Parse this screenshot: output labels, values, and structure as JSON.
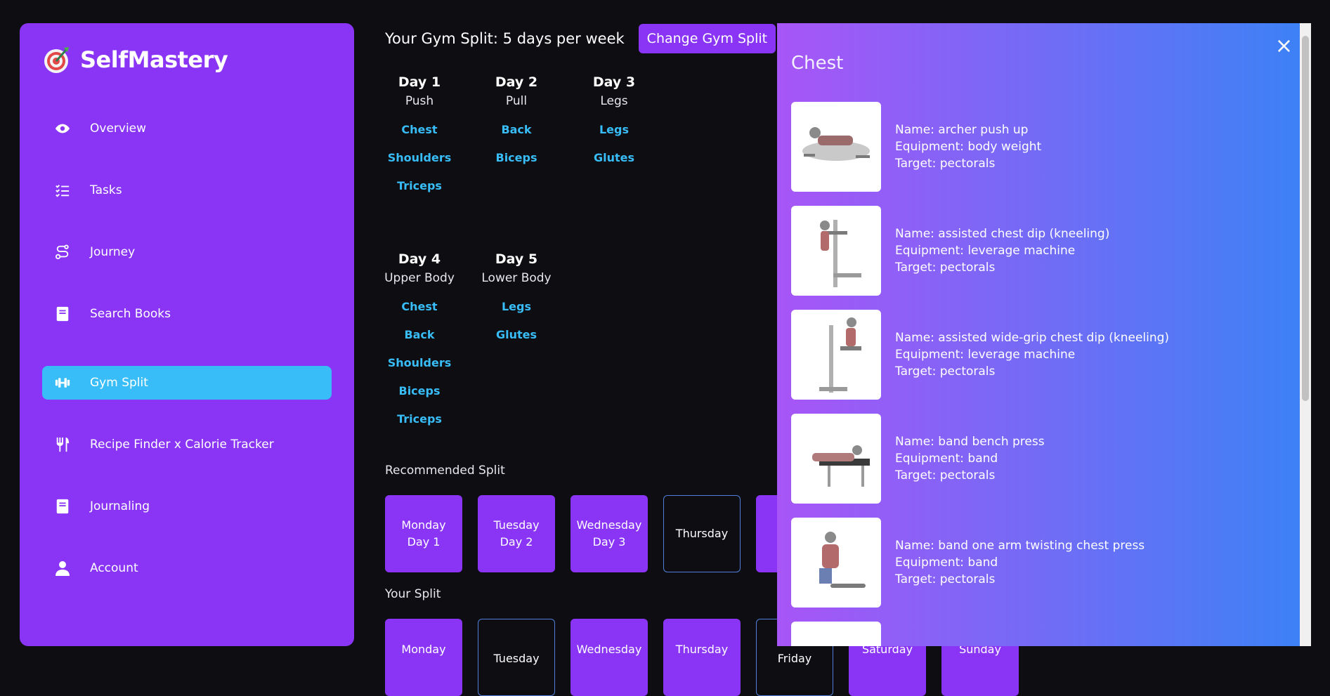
{
  "brand": {
    "name": "SelfMastery",
    "icon": "target-icon"
  },
  "nav": [
    {
      "label": "Overview",
      "icon": "eye-icon"
    },
    {
      "label": "Tasks",
      "icon": "checklist-icon"
    },
    {
      "label": "Journey",
      "icon": "route-icon"
    },
    {
      "label": "Search Books",
      "icon": "book-icon"
    },
    {
      "label": "Gym Split",
      "icon": "dumbbell-icon",
      "active": true
    },
    {
      "label": "Recipe Finder x Calorie Tracker",
      "icon": "utensils-icon"
    },
    {
      "label": "Journaling",
      "icon": "journal-icon"
    },
    {
      "label": "Account",
      "icon": "user-icon"
    }
  ],
  "header": {
    "title": "Your Gym Split: 5 days per week",
    "change_button": "Change Gym Split"
  },
  "days": [
    {
      "title": "Day 1",
      "type": "Push",
      "muscles": [
        "Chest",
        "Shoulders",
        "Triceps"
      ]
    },
    {
      "title": "Day 2",
      "type": "Pull",
      "muscles": [
        "Back",
        "Biceps"
      ]
    },
    {
      "title": "Day 3",
      "type": "Legs",
      "muscles": [
        "Legs",
        "Glutes"
      ]
    },
    {
      "title": "Day 4",
      "type": "Upper Body",
      "muscles": [
        "Chest",
        "Back",
        "Shoulders",
        "Biceps",
        "Triceps"
      ]
    },
    {
      "title": "Day 5",
      "type": "Lower Body",
      "muscles": [
        "Legs",
        "Glutes"
      ]
    }
  ],
  "recommended": {
    "label": "Recommended Split",
    "tiles": [
      {
        "day": "Monday",
        "sub": "Day 1",
        "filled": true
      },
      {
        "day": "Tuesday",
        "sub": "Day 2",
        "filled": true
      },
      {
        "day": "Wednesday",
        "sub": "Day 3",
        "filled": true
      },
      {
        "day": "Thursday",
        "sub": "",
        "filled": false
      },
      {
        "day": "",
        "sub": "",
        "filled": true
      }
    ]
  },
  "your_split": {
    "label": "Your Split",
    "tiles": [
      {
        "day": "Monday",
        "filled": true
      },
      {
        "day": "Tuesday",
        "filled": false
      },
      {
        "day": "Wednesday",
        "filled": true
      },
      {
        "day": "Thursday",
        "filled": true
      },
      {
        "day": "Friday",
        "filled": false
      },
      {
        "day": "Saturday",
        "filled": true
      },
      {
        "day": "Sunday",
        "filled": true
      }
    ]
  },
  "modal": {
    "title": "Chest",
    "close": "×",
    "exercises": [
      {
        "name": "Name: archer push up",
        "equipment": "Equipment: body weight",
        "target": "Target: pectorals"
      },
      {
        "name": "Name: assisted chest dip (kneeling)",
        "equipment": "Equipment: leverage machine",
        "target": "Target: pectorals"
      },
      {
        "name": "Name: assisted wide-grip chest dip (kneeling)",
        "equipment": "Equipment: leverage machine",
        "target": "Target: pectorals"
      },
      {
        "name": "Name: band bench press",
        "equipment": "Equipment: band",
        "target": "Target: pectorals"
      },
      {
        "name": "Name: band one arm twisting chest press",
        "equipment": "Equipment: band",
        "target": "Target: pectorals"
      }
    ]
  },
  "colors": {
    "accent": "#8a35f5",
    "active": "#38bdf8",
    "background": "#0d0d12"
  }
}
